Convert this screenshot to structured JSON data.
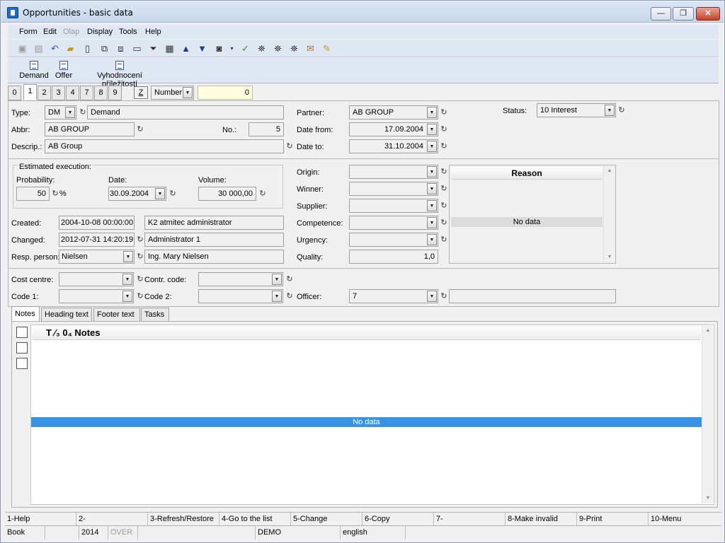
{
  "window": {
    "title": "Opportunities - basic data",
    "min": "—",
    "max": "❐",
    "close": "✕"
  },
  "menu": [
    "Form",
    "Edit",
    "Olap",
    "Display",
    "Tools",
    "Help"
  ],
  "menu_disabled": [
    "Olap"
  ],
  "reports": [
    "Demand",
    "Offer",
    "Vyhodnocení příležitostí"
  ],
  "page_tabs": [
    "0",
    "1",
    "2",
    "3",
    "4",
    "7",
    "8",
    "9"
  ],
  "selected_page_tab": "1",
  "z_button": "Z",
  "sort": {
    "field": "Number",
    "value": "0"
  },
  "form": {
    "type_label": "Type:",
    "type_code": "DM",
    "type_name": "Demand",
    "abbr_label": "Abbr:",
    "abbr": "AB GROUP",
    "no_label": "No.:",
    "no": "5",
    "descr_label": "Descrip.:",
    "descr": "AB Group",
    "partner_label": "Partner:",
    "partner": "AB GROUP",
    "date_from_label": "Date from:",
    "date_from": "17.09.2004",
    "date_to_label": "Date to:",
    "date_to": "31.10.2004",
    "status_label": "Status:",
    "status": "10 Interest",
    "est_title": "Estimated execution:",
    "probability_label": "Probability:",
    "probability": "50",
    "percent": "%",
    "date_label": "Date:",
    "date": "30.09.2004",
    "volume_label": "Volume:",
    "volume": "30 000,00",
    "created_label": "Created:",
    "created": "2004-10-08 00:00:00",
    "created_by": "K2 atmitec administrator",
    "changed_label": "Changed:",
    "changed": "2012-07-31 14:20:19",
    "changed_by": "Administrator 1",
    "resp_label": "Resp. person:",
    "resp": "Nielsen",
    "resp_name": "Ing. Mary Nielsen",
    "origin_label": "Origin:",
    "winner_label": "Winner:",
    "supplier_label": "Supplier:",
    "competence_label": "Competence:",
    "urgency_label": "Urgency:",
    "quality_label": "Quality:",
    "quality": "1,0",
    "reason_header": "Reason",
    "reason_empty": "No data",
    "cost_centre_label": "Cost centre:",
    "contr_code_label": "Contr. code:",
    "code1_label": "Code 1:",
    "code2_label": "Code 2:",
    "officer_label": "Officer:",
    "officer": "7"
  },
  "sub_tabs": [
    "Notes",
    "Heading text",
    "Footer text",
    "Tasks"
  ],
  "notes": {
    "header": "T ⁄₃ 0₄ Notes",
    "empty": "No data"
  },
  "fkeys": [
    "1-Help",
    "2-",
    "3-Refresh/Restore",
    "4-Go to the list",
    "5-Change",
    "6-Copy",
    "7-",
    "8-Make invalid",
    "9-Print",
    "10-Menu"
  ],
  "status": {
    "book": "Book",
    "year": "2014",
    "over": "OVER",
    "db": "DEMO",
    "lang": "english"
  },
  "icons": {
    "history": "↻",
    "dropdown": "▼"
  }
}
